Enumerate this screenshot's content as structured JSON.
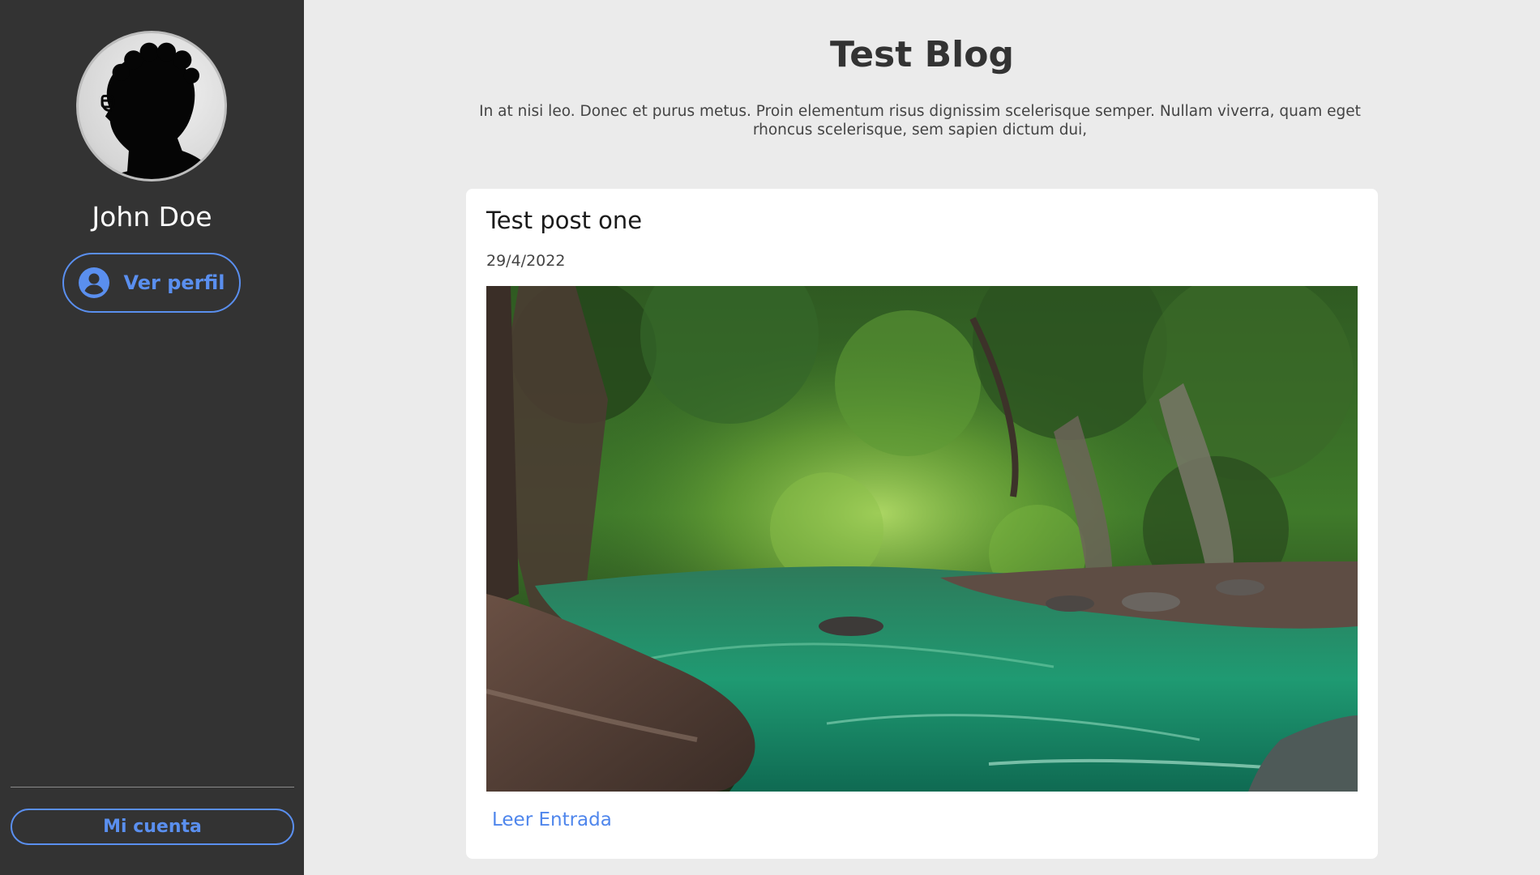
{
  "sidebar": {
    "user_name": "John Doe",
    "profile_button_label": "Ver perfil",
    "profile_icon": "user-circle-icon",
    "account_button_label": "Mi cuenta"
  },
  "header": {
    "title": "Test Blog",
    "description": "In at nisi leo. Donec et purus metus. Proin elementum risus dignissim scelerisque semper. Nullam viverra, quam eget rhoncus scelerisque, sem sapien dictum dui,"
  },
  "posts": [
    {
      "title": "Test post one",
      "date": "29/4/2022",
      "read_label": "Leer Entrada"
    }
  ],
  "colors": {
    "sidebar_bg": "#333333",
    "main_bg": "#ebebeb",
    "accent": "#5a8fef",
    "link": "#4f86ec"
  }
}
